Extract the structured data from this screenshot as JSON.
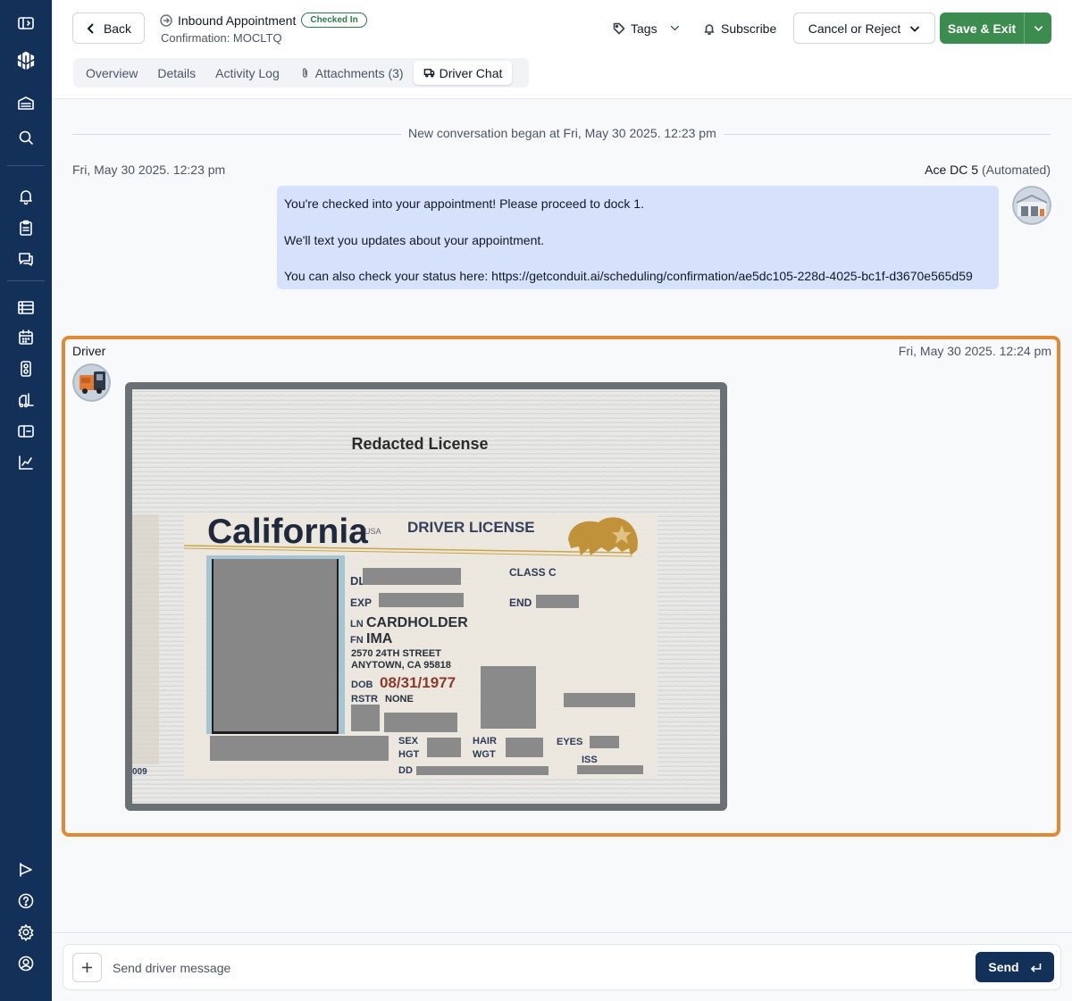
{
  "sidebar": {
    "top_icons": [
      "sidebar-toggle-icon",
      "logo-icon",
      "warehouse-icon",
      "search-icon"
    ],
    "group1": [
      "bell-icon",
      "clipboard-icon",
      "chat-icon"
    ],
    "group2": [
      "list-icon",
      "calendar-icon",
      "door-icon",
      "forklift-icon",
      "map-icon",
      "chart-line-icon"
    ],
    "bottom": [
      "presentation-icon",
      "help-icon",
      "gear-icon",
      "user-circle-icon"
    ]
  },
  "header": {
    "back_label": "Back",
    "title": "Inbound Appointment",
    "status_badge": "Checked In",
    "confirmation": "Confirmation: MOCLTQ",
    "tags_label": "Tags",
    "subscribe_label": "Subscribe",
    "cancel_label": "Cancel or Reject",
    "save_label": "Save & Exit",
    "status_color": "#2f7a4c",
    "save_color": "#3d8c4f"
  },
  "tabs": [
    {
      "label": "Overview"
    },
    {
      "label": "Details"
    },
    {
      "label": "Activity Log"
    },
    {
      "label": "Attachments (3)"
    },
    {
      "label": "Driver Chat",
      "active": true
    }
  ],
  "conversation": {
    "start_text": "New conversation began at Fri, May 30 2025. 12:23 pm",
    "auto_message": {
      "timestamp": "Fri, May 30 2025. 12:23 pm",
      "sender": "Ace DC 5",
      "sender_note": "(Automated)",
      "lines": [
        "You're checked into your appointment! Please proceed to dock 1.",
        "We'll text you updates about your appointment.",
        "You can also check your status here: https://getconduit.ai/scheduling/confirmation/ae5dc105-228d-4025-bc1f-d3670e565d59"
      ]
    },
    "driver_message": {
      "sender": "Driver",
      "timestamp": "Fri, May 30 2025. 12:24 pm",
      "highlight_color": "#e08a35",
      "license": {
        "heading": "Redacted License",
        "state": "California",
        "country": "USA",
        "doc_type": "DRIVER LICENSE",
        "class": "CLASS C",
        "dl_label": "DL",
        "exp_label": "EXP",
        "end_label": "END",
        "ln_label": "LN",
        "last_name": "CARDHOLDER",
        "fn_label": "FN",
        "first_name": "IMA",
        "address1": "2570 24TH STREET",
        "address2": "ANYTOWN, CA 95818",
        "dob_label": "DOB",
        "dob": "08/31/1977",
        "rstr_label": "RSTR",
        "rstr": "NONE",
        "sex_label": "SEX",
        "hgt_label": "HGT",
        "hair_label": "HAIR",
        "wgt_label": "WGT",
        "eyes_label": "EYES",
        "iss_label": "ISS",
        "dd_label": "DD",
        "edge_number": "009"
      }
    }
  },
  "composer": {
    "placeholder": "Send driver message",
    "send_label": "Send",
    "send_color": "#123058"
  }
}
